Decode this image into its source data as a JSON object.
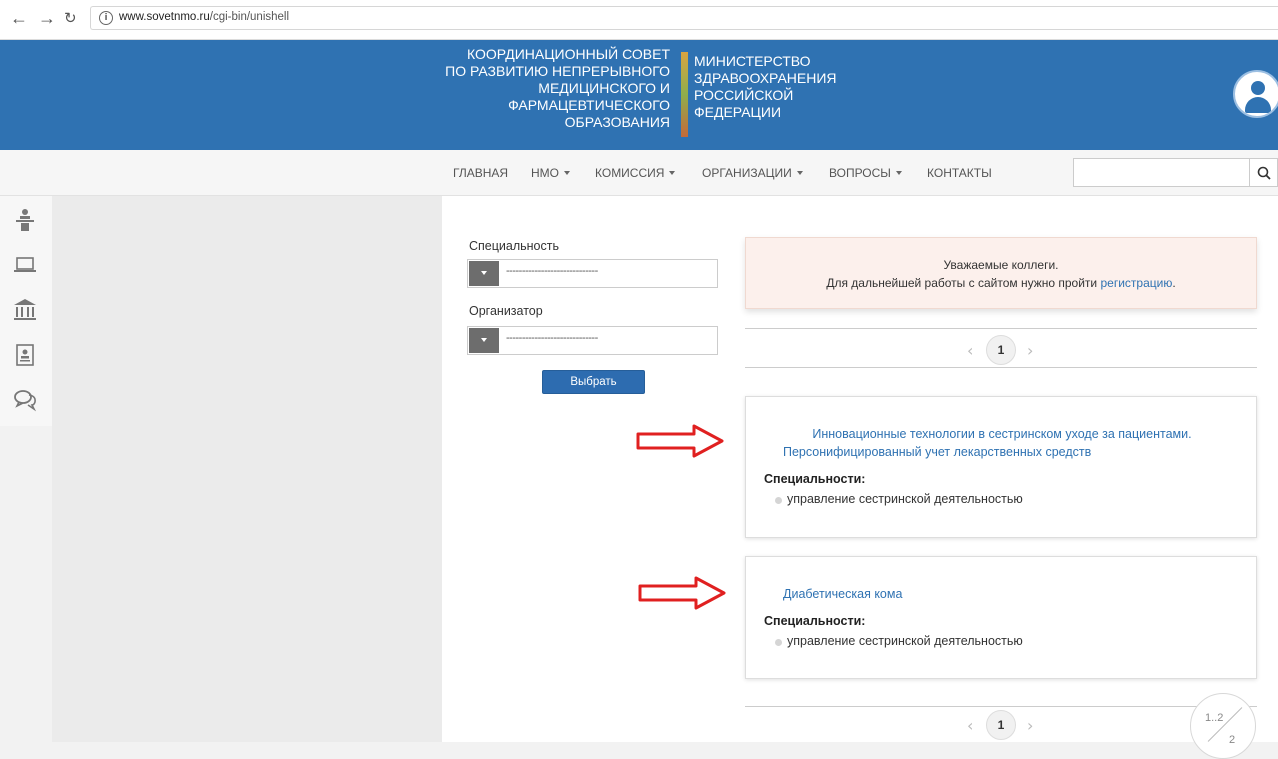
{
  "browser": {
    "url_host": "www.sovetnmo.ru",
    "url_path": "/cgi-bin/unishell"
  },
  "header": {
    "council_lines": [
      "КООРДИНАЦИОННЫЙ СОВЕТ",
      "ПО РАЗВИТИЮ НЕПРЕРЫВНОГО",
      "МЕДИЦИНСКОГО И",
      "ФАРМАЦЕВТИЧЕСКОГО",
      "ОБРАЗОВАНИЯ"
    ],
    "ministry_lines": [
      "МИНИСТЕРСТВО",
      "ЗДРАВООХРАНЕНИЯ",
      "РОССИЙСКОЙ",
      "ФЕДЕРАЦИИ"
    ]
  },
  "menu": {
    "home": "ГЛАВНАЯ",
    "nmo": "НМО",
    "commission": "КОМИССИЯ",
    "organizations": "ОРГАНИЗАЦИИ",
    "questions": "ВОПРОСЫ",
    "contacts": "КОНТАКТЫ"
  },
  "search": {
    "value": "",
    "placeholder": ""
  },
  "filters": {
    "specialty_label": "Специальность",
    "specialty_value": "-----------------------------",
    "organizer_label": "Организатор",
    "organizer_value": "-----------------------------",
    "choose_button": "Выбрать"
  },
  "notice": {
    "line1": "Уважаемые коллеги.",
    "line2_prefix": "Для дальнейшей работы с сайтом нужно пройти ",
    "link": "регистрацию",
    "line2_suffix": "."
  },
  "pagination": {
    "current_page": "1",
    "prev": "‹",
    "next": "›"
  },
  "cards": [
    {
      "title_line1": "Инновационные технологии в сестринском уходе за пациентами.",
      "title_line2": "Персонифицированный учет лекарственных средств",
      "spec_label": "Специальности:",
      "spec_item": "управление сестринской деятельностью"
    },
    {
      "title_line1": "Диабетическая кома",
      "spec_label": "Специальности:",
      "spec_item": "управление сестринской деятельностью"
    }
  ],
  "page_indicator": {
    "range": "1..2",
    "total": "2"
  },
  "colors": {
    "header_blue": "#2f72b2",
    "link_blue": "#2f72b2",
    "notice_bg": "#fcf0ec",
    "arrow_red": "#e02020"
  }
}
